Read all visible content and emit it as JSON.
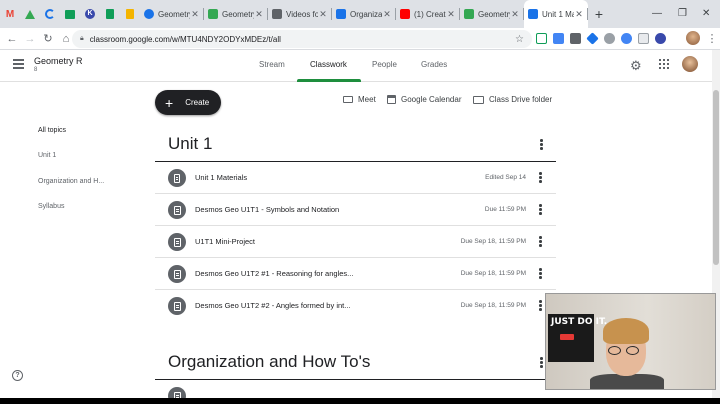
{
  "browser": {
    "pinned_tabs": [
      {
        "icon": "gmail-icon",
        "color": "#ea4335"
      },
      {
        "icon": "drive-icon",
        "color": "#34a853"
      },
      {
        "icon": "loading-icon",
        "color": "#1a73e8"
      },
      {
        "icon": "classroom-icon",
        "color": "#0f9d58"
      },
      {
        "icon": "k-icon",
        "color": "#3949ab"
      },
      {
        "icon": "sheets-icon",
        "color": "#0f9d58"
      },
      {
        "icon": "slides-icon",
        "color": "#f4b400"
      }
    ],
    "tabs": [
      {
        "title": "Geometry",
        "icon_color": "#1a73e8",
        "active": false
      },
      {
        "title": "Geometry",
        "icon_color": "#34a853",
        "active": false
      },
      {
        "title": "Videos for",
        "icon_color": "#5f6368",
        "active": false
      },
      {
        "title": "Organizatio",
        "icon_color": "#1a73e8",
        "active": false
      },
      {
        "title": "(1) Creatin",
        "icon_color": "#ff0000",
        "active": false
      },
      {
        "title": "Geometry",
        "icon_color": "#34a853",
        "active": false
      },
      {
        "title": "Unit 1 Mat",
        "icon_color": "#1a73e8",
        "active": true
      }
    ],
    "url": "classroom.google.com/w/MTU4NDY2ODYxMDEz/t/all"
  },
  "classroom": {
    "class_name": "Geometry R",
    "class_section": "8",
    "tabs": [
      "Stream",
      "Classwork",
      "People",
      "Grades"
    ],
    "active_tab": "Classwork"
  },
  "topics": {
    "all": "All topics",
    "items": [
      "Unit 1",
      "Organization and H...",
      "Syllabus"
    ]
  },
  "actions": {
    "create": "Create",
    "meet": "Meet",
    "calendar": "Google Calendar",
    "drive": "Class Drive folder"
  },
  "sections": [
    {
      "title": "Unit 1",
      "items": [
        {
          "title": "Unit 1 Materials",
          "due": "Edited Sep 14"
        },
        {
          "title": "Desmos Geo U1T1 - Symbols and Notation",
          "due": "Due 11:59 PM"
        },
        {
          "title": "U1T1 Mini-Project",
          "due": "Due Sep 18, 11:59 PM"
        },
        {
          "title": "Desmos Geo U1T2 #1 - Reasoning for angles...",
          "due": "Due Sep 18, 11:59 PM"
        },
        {
          "title": "Desmos Geo U1T2 #2 - Angles formed by int...",
          "due": "Due Sep 18, 11:59 PM"
        }
      ]
    },
    {
      "title": "Organization and How To's",
      "items": []
    }
  ],
  "webcam": {
    "poster_text": "JUST DO IT."
  }
}
